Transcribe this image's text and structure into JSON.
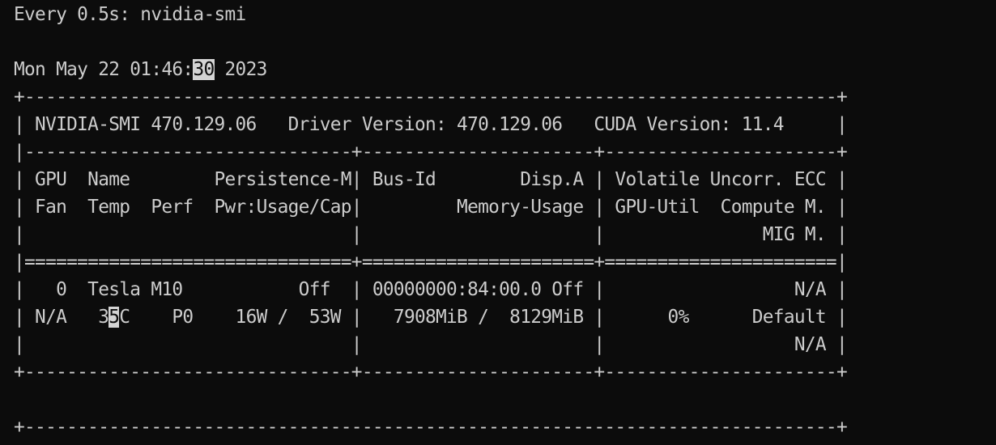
{
  "header": {
    "watch_command": "Every 0.5s: nvidia-smi",
    "timestamp_prefix": "Mon May 22 01:46:",
    "timestamp_seconds": "30",
    "timestamp_suffix": " 2023"
  },
  "table": {
    "border_top": "+-----------------------------------------------------------------------------+",
    "version_line": "| NVIDIA-SMI 470.129.06   Driver Version: 470.129.06   CUDA Version: 11.4     |",
    "separator_dash": "|-------------------------------+----------------------+----------------------+",
    "header_row_1": "| GPU  Name        Persistence-M| Bus-Id        Disp.A | Volatile Uncorr. ECC |",
    "header_row_2": "| Fan  Temp  Perf  Pwr:Usage/Cap|         Memory-Usage | GPU-Util  Compute M. |",
    "header_row_3": "|                               |                      |               MIG M. |",
    "separator_eq": "|===============================+======================+======================|",
    "gpu_row_1": "|   0  Tesla M10           Off  | 00000000:84:00.0 Off |                  N/A |",
    "gpu_row_2_prefix": "| N/A   3",
    "gpu_row_2_cursor": "5",
    "gpu_row_2_suffix": "C    P0    16W /  53W |   7908MiB /  8129MiB |      0%      Default |",
    "gpu_row_3": "|                               |                      |                  N/A |",
    "border_bottom": "+-------------------------------+----------------------+----------------------+",
    "processes_border": "+-----------------------------------------------------------------------------+"
  },
  "colors": {
    "background": "#0c0c0c",
    "foreground": "#cccccc",
    "highlight_bg": "#d4d4d4"
  }
}
